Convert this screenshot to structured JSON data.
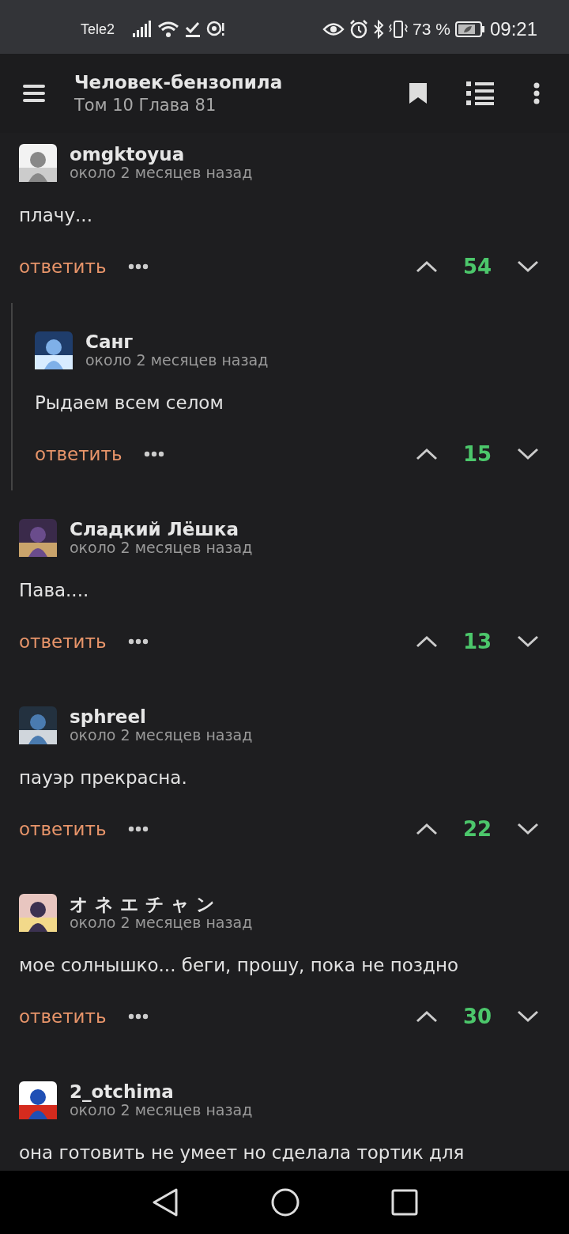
{
  "status_bar": {
    "carrier": "Tele2",
    "battery": "73 %",
    "time": "09:21"
  },
  "header": {
    "title": "Человек-бензопила",
    "subtitle": "Том 10 Глава 81"
  },
  "comments": [
    {
      "author": "omgktoyua",
      "time": "около 2 месяцев назад",
      "text": "плачу...",
      "reply": "ответить",
      "score": "54",
      "replies": [
        {
          "author": "Санг",
          "time": "около 2 месяцев назад",
          "text": "Рыдаем всем селом",
          "reply": "ответить",
          "score": "15"
        }
      ]
    },
    {
      "author": "Сладкий Лёшка",
      "time": "около 2 месяцев назад",
      "text": "Пава....",
      "reply": "ответить",
      "score": "13"
    },
    {
      "author": "sphreel",
      "time": "около 2 месяцев назад",
      "text": "пауэр прекрасна.",
      "reply": "ответить",
      "score": "22"
    },
    {
      "author": "オ ネ エ チ ャ ン",
      "time": "около 2 месяцев назад",
      "text": "мое солнышко... беги, прошу, пока не поздно",
      "reply": "ответить",
      "score": "30"
    },
    {
      "author": "2_otchima",
      "time": "около 2 месяцев назад",
      "text": "она готовить не умеет но сделала тортик для"
    }
  ]
}
